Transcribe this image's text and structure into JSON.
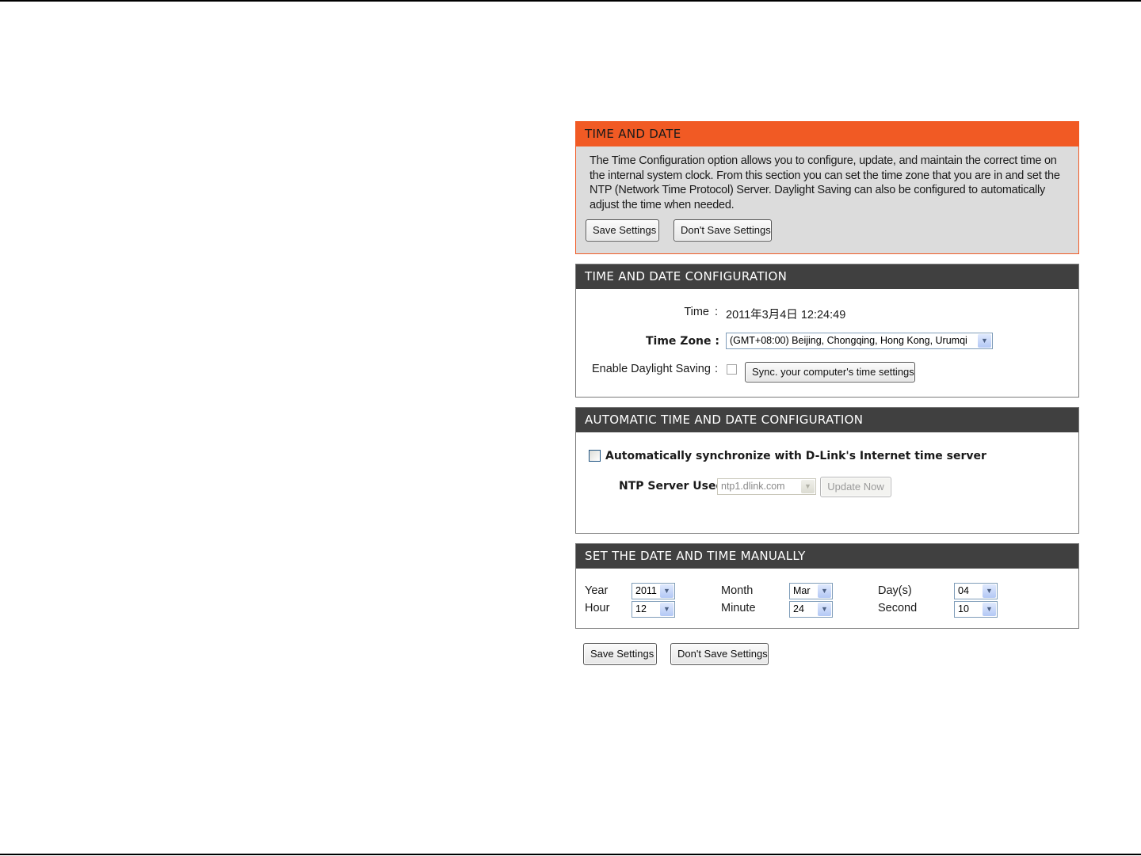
{
  "intro": {
    "title": "TIME AND DATE",
    "description": "The Time Configuration option allows you to configure, update, and maintain the correct time on the internal system clock. From this section you can set the time zone that you are in and set the NTP (Network Time Protocol) Server. Daylight Saving can also be configured to automatically adjust the time when needed.",
    "save_label": "Save Settings",
    "dont_save_label": "Don't Save Settings"
  },
  "config": {
    "title": "TIME AND DATE CONFIGURATION",
    "time_label": "Time",
    "separator": ":",
    "time_value": "2011年3月4日 12:24:49",
    "timezone_label": "Time Zone :",
    "timezone_value": "(GMT+08:00) Beijing, Chongqing, Hong Kong, Urumqi",
    "daylight_label": "Enable Daylight Saving",
    "daylight_checked": false,
    "sync_label": "Sync. your computer's time settings"
  },
  "auto": {
    "title": "AUTOMATIC TIME AND DATE CONFIGURATION",
    "sync_checkbox_label": "Automatically synchronize with D-Link's Internet time server",
    "sync_checked": false,
    "ntp_label": "NTP Server Used :",
    "ntp_value": "ntp1.dlink.com",
    "update_label": "Update Now"
  },
  "manual": {
    "title": "SET THE DATE AND TIME MANUALLY",
    "year_label": "Year",
    "year_value": "2011",
    "month_label": "Month",
    "month_value": "Mar",
    "day_label": "Day(s)",
    "day_value": "04",
    "hour_label": "Hour",
    "hour_value": "12",
    "minute_label": "Minute",
    "minute_value": "24",
    "second_label": "Second",
    "second_value": "10"
  },
  "footer": {
    "save_label": "Save Settings",
    "dont_save_label": "Don't Save Settings"
  },
  "colors": {
    "accent_orange": "#f15a24",
    "header_dark": "#404040",
    "intro_bg": "#dcdcdc"
  },
  "icons": {
    "dropdown": "chevron-down-icon"
  }
}
